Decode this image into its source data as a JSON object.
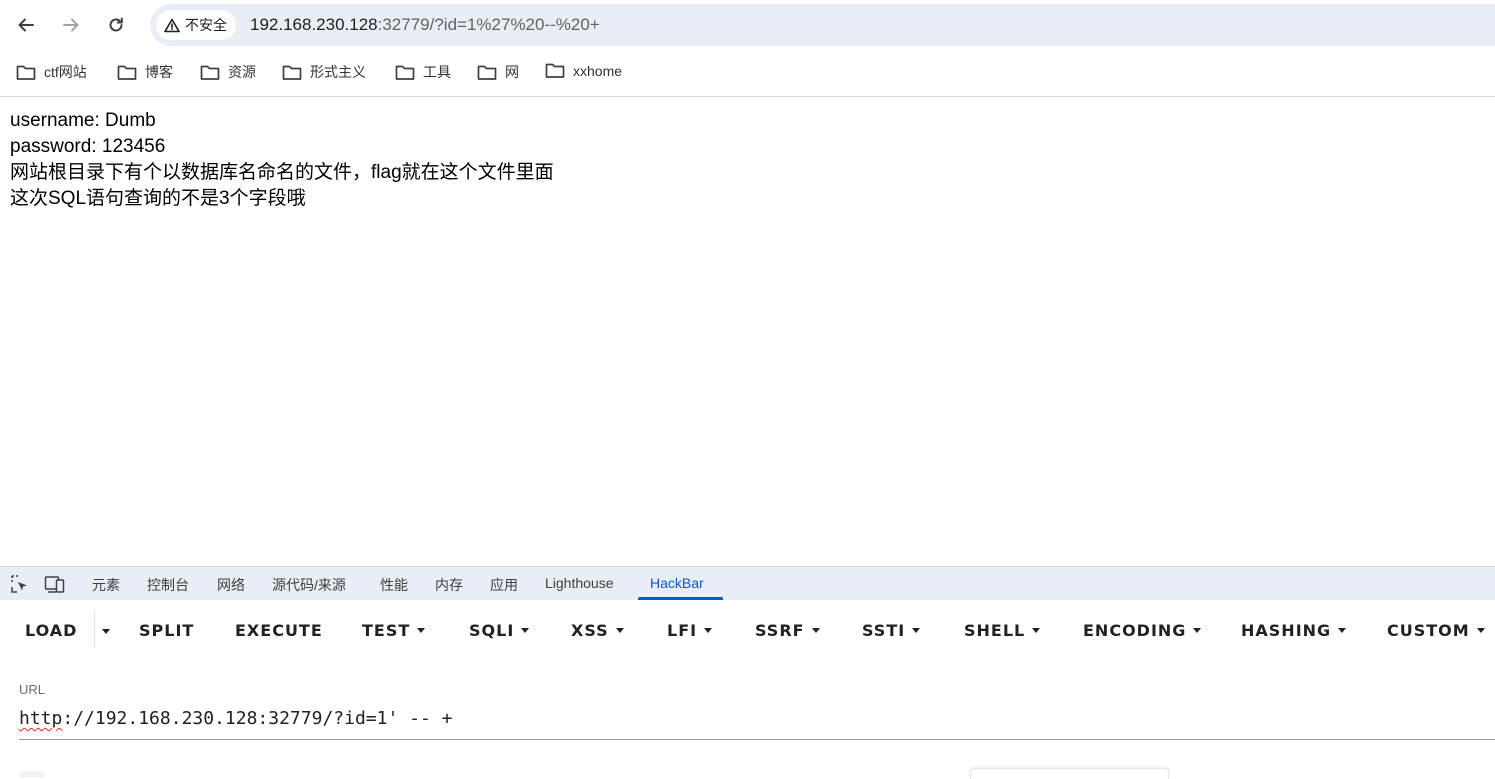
{
  "browser": {
    "security_label": "不安全",
    "url_host": "192.168.230.128",
    "url_rest": ":32779/?id=1%27%20--%20+"
  },
  "bookmarks": [
    {
      "label": "ctf网站",
      "icon": "folder-icon"
    },
    {
      "label": "博客",
      "icon": "folder-icon"
    },
    {
      "label": "资源",
      "icon": "folder-icon"
    },
    {
      "label": "形式主义",
      "icon": "folder-icon"
    },
    {
      "label": "工具",
      "icon": "folder-icon"
    },
    {
      "label": "网",
      "icon": "folder-icon"
    },
    {
      "label": "xxhome",
      "icon": "folder-icon"
    }
  ],
  "page": {
    "line1": "username: Dumb",
    "line2": "password: 123456",
    "line3": "网站根目录下有个以数据库名命名的文件，flag就在这个文件里面",
    "line4": "这次SQL语句查询的不是3个字段哦"
  },
  "devtools": {
    "tabs": [
      "元素",
      "控制台",
      "网络",
      "源代码/来源",
      "性能",
      "内存",
      "应用",
      "Lighthouse",
      "HackBar"
    ],
    "active_tab": "HackBar",
    "accent": "#0b57d0"
  },
  "hackbar": {
    "menu": [
      "LOAD",
      "SPLIT",
      "EXECUTE",
      "TEST",
      "SQLI",
      "XSS",
      "LFI",
      "SSRF",
      "SSTI",
      "SHELL",
      "ENCODING",
      "HASHING",
      "CUSTOM"
    ],
    "url_label": "URL",
    "url_scheme": "http",
    "url_value": "://192.168.230.128:32779/?id=1' -- +"
  }
}
